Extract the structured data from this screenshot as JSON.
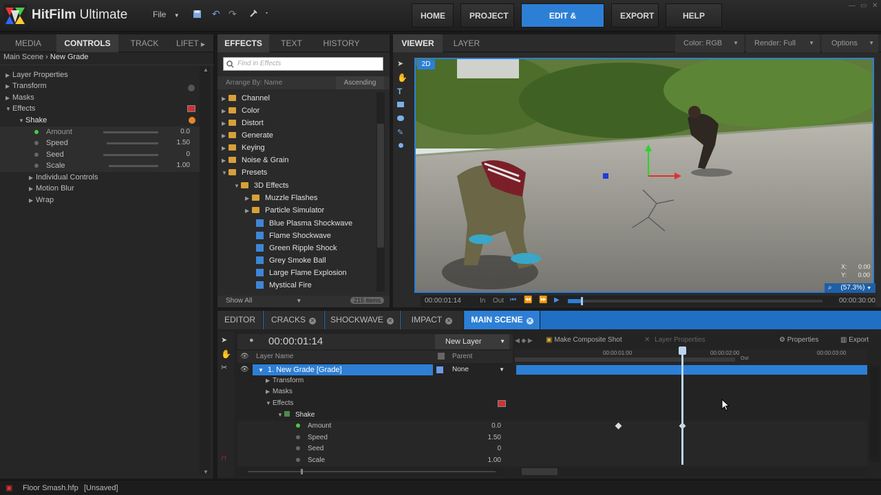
{
  "app": {
    "title_bold": "HitFilm",
    "title_rest": " Ultimate",
    "file_menu": "File"
  },
  "nav": {
    "home": "HOME",
    "project": "PROJECT",
    "edit_effects": "EDIT & EFFECTS",
    "export": "EXPORT",
    "help": "HELP"
  },
  "left_panel": {
    "tabs": [
      "MEDIA",
      "CONTROLS",
      "TRACK",
      "LIFET"
    ],
    "breadcrumb": {
      "scene": "Main Scene",
      "sep": "›",
      "layer": "New Grade"
    },
    "tree": [
      {
        "label": "Layer Properties"
      },
      {
        "label": "Transform"
      },
      {
        "label": "Masks"
      },
      {
        "label": "Effects"
      },
      {
        "label": "Shake"
      },
      {
        "label": "Amount",
        "value": "0.0"
      },
      {
        "label": "Speed",
        "value": "1.50"
      },
      {
        "label": "Seed",
        "value": "0"
      },
      {
        "label": "Scale",
        "value": "1.00"
      },
      {
        "label": "Individual Controls"
      },
      {
        "label": "Motion Blur"
      },
      {
        "label": "Wrap"
      }
    ]
  },
  "effects_panel": {
    "tabs": [
      "EFFECTS",
      "TEXT",
      "HISTORY"
    ],
    "search_placeholder": "Find in Effects",
    "arrange": "Arrange By: Name",
    "order": "Ascending",
    "items": [
      {
        "label": "Channel"
      },
      {
        "label": "Color"
      },
      {
        "label": "Distort"
      },
      {
        "label": "Generate"
      },
      {
        "label": "Keying"
      },
      {
        "label": "Noise & Grain"
      },
      {
        "label": "Presets"
      },
      {
        "label": "3D Effects"
      },
      {
        "label": "Muzzle Flashes"
      },
      {
        "label": "Particle Simulator"
      },
      {
        "label": "Blue Plasma Shockwave"
      },
      {
        "label": "Flame Shockwave"
      },
      {
        "label": "Green Ripple Shock"
      },
      {
        "label": "Grey Smoke Ball"
      },
      {
        "label": "Large Flame Explosion"
      },
      {
        "label": "Mystical Fire"
      }
    ],
    "show": "Show All",
    "count": "215 items"
  },
  "viewer": {
    "tabs": [
      "VIEWER",
      "LAYER"
    ],
    "color": "Color: RGB",
    "render": "Render: Full",
    "options": "Options",
    "mode": "2D",
    "x_label": "X:",
    "x_val": "0.00",
    "y_label": "Y:",
    "y_val": "0.00",
    "zoom": "(57.3%)",
    "time_current": "00:00:01:14",
    "in": "In",
    "out": "Out",
    "time_end": "00:00:30:00"
  },
  "timeline": {
    "tabs": [
      "EDITOR",
      "CRACKS",
      "SHOCKWAVE",
      "IMPACT",
      "MAIN SCENE"
    ],
    "timecode": "00:00:01:14",
    "new_layer": "New Layer",
    "composite": "Make Composite Shot",
    "layer_props": "Layer Properties",
    "properties": "Properties",
    "export": "Export",
    "col_layer": "Layer Name",
    "col_parent": "Parent",
    "ruler": [
      "00:00:01:00",
      "00:00:02:00",
      "00:00:03:00"
    ],
    "out_marker": "Out",
    "layer": "1. New Grade [Grade]",
    "parent": "None",
    "rows": [
      {
        "label": "Transform"
      },
      {
        "label": "Masks"
      },
      {
        "label": "Effects"
      },
      {
        "label": "Shake"
      },
      {
        "label": "Amount",
        "value": "0.0"
      },
      {
        "label": "Speed",
        "value": "1.50"
      },
      {
        "label": "Seed",
        "value": "0"
      },
      {
        "label": "Scale",
        "value": "1.00"
      }
    ]
  },
  "statusbar": {
    "file": "Floor Smash.hfp",
    "state": "[Unsaved]"
  },
  "colors": {
    "accent": "#2d7fd6",
    "bg": "#262626",
    "folder": "#d7a03a"
  }
}
